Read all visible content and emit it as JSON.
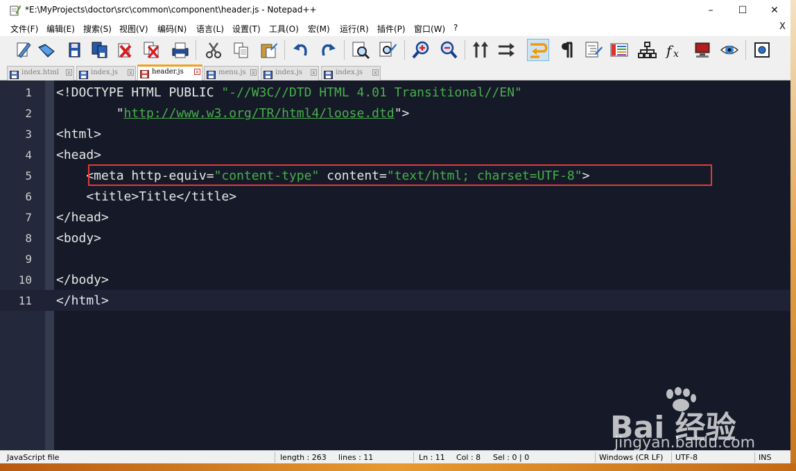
{
  "window": {
    "title": "*E:\\MyProjects\\doctor\\src\\common\\component\\header.js - Notepad++",
    "minimize": "–",
    "maximize": "☐",
    "close": "✕"
  },
  "menu": {
    "items": [
      "文件(F)",
      "编辑(E)",
      "搜索(S)",
      "视图(V)",
      "编码(N)",
      "语言(L)",
      "设置(T)",
      "工具(O)",
      "宏(M)",
      "运行(R)",
      "插件(P)",
      "窗口(W)",
      "?"
    ],
    "close": "X"
  },
  "toolbar": {
    "icons": [
      "new-file-icon",
      "open-file-icon",
      "save-icon",
      "save-all-icon",
      "close-icon",
      "close-all-icon",
      "print-icon",
      "cut-icon",
      "copy-icon",
      "paste-icon",
      "undo-icon",
      "redo-icon",
      "find-icon",
      "replace-icon",
      "zoom-in-icon",
      "zoom-out-icon",
      "sync-vertical-icon",
      "sync-horizontal-icon",
      "word-wrap-icon",
      "show-all-chars-icon",
      "indent-guide-icon",
      "udl-icon",
      "doc-map-icon",
      "function-list-icon",
      "monitor-icon",
      "eye-icon",
      "record-macro-icon"
    ]
  },
  "tabs": [
    {
      "label": "index.html",
      "active": false
    },
    {
      "label": "index.js",
      "active": false
    },
    {
      "label": "header.js",
      "active": true
    },
    {
      "label": "menu.js",
      "active": false
    },
    {
      "label": "index.js",
      "active": false
    },
    {
      "label": "index.js",
      "active": false
    }
  ],
  "editor": {
    "current_line": 11,
    "highlighted_line": 5,
    "lines": [
      {
        "num": "1",
        "segments": [
          {
            "t": "<!DOCTYPE HTML PUBLIC ",
            "c": "plain"
          },
          {
            "t": "\"-//W3C//DTD HTML 4.01 Transitional//EN\"",
            "c": "str"
          }
        ]
      },
      {
        "num": "2",
        "segments": [
          {
            "t": "        \"",
            "c": "plain"
          },
          {
            "t": "http://www.w3.org/TR/html4/loose.dtd",
            "c": "url"
          },
          {
            "t": "\">",
            "c": "plain"
          }
        ]
      },
      {
        "num": "3",
        "segments": [
          {
            "t": "<html>",
            "c": "plain"
          }
        ]
      },
      {
        "num": "4",
        "segments": [
          {
            "t": "<head>",
            "c": "plain"
          }
        ]
      },
      {
        "num": "5",
        "segments": [
          {
            "t": "    <meta http-equiv=",
            "c": "plain"
          },
          {
            "t": "\"content-type\"",
            "c": "str"
          },
          {
            "t": " content=",
            "c": "plain"
          },
          {
            "t": "\"text/html; charset=UTF-8\"",
            "c": "str"
          },
          {
            "t": ">",
            "c": "plain"
          }
        ]
      },
      {
        "num": "6",
        "segments": [
          {
            "t": "    <title>Title</title>",
            "c": "plain"
          }
        ]
      },
      {
        "num": "7",
        "segments": [
          {
            "t": "</head>",
            "c": "plain"
          }
        ]
      },
      {
        "num": "8",
        "segments": [
          {
            "t": "<body>",
            "c": "plain"
          }
        ]
      },
      {
        "num": "9",
        "segments": [
          {
            "t": "",
            "c": "plain"
          }
        ]
      },
      {
        "num": "10",
        "segments": [
          {
            "t": "</body>",
            "c": "plain"
          }
        ]
      },
      {
        "num": "11",
        "segments": [
          {
            "t": "</html>",
            "c": "plain"
          }
        ]
      }
    ]
  },
  "status": {
    "file_type": "JavaScript file",
    "length": "length : 263",
    "lines": "lines : 11",
    "ln": "Ln : 11",
    "col": "Col : 8",
    "sel": "Sel : 0 | 0",
    "eol": "Windows (CR LF)",
    "encoding": "UTF-8",
    "mode": "INS"
  },
  "watermark": {
    "brand": "Bai   经验",
    "sub": "jingyan.baidu.com"
  },
  "colors": {
    "editor_bg": "#161a28",
    "string": "#46b04a",
    "highlight_box": "#e53935",
    "active_tab_accent": "#f2a01a"
  }
}
